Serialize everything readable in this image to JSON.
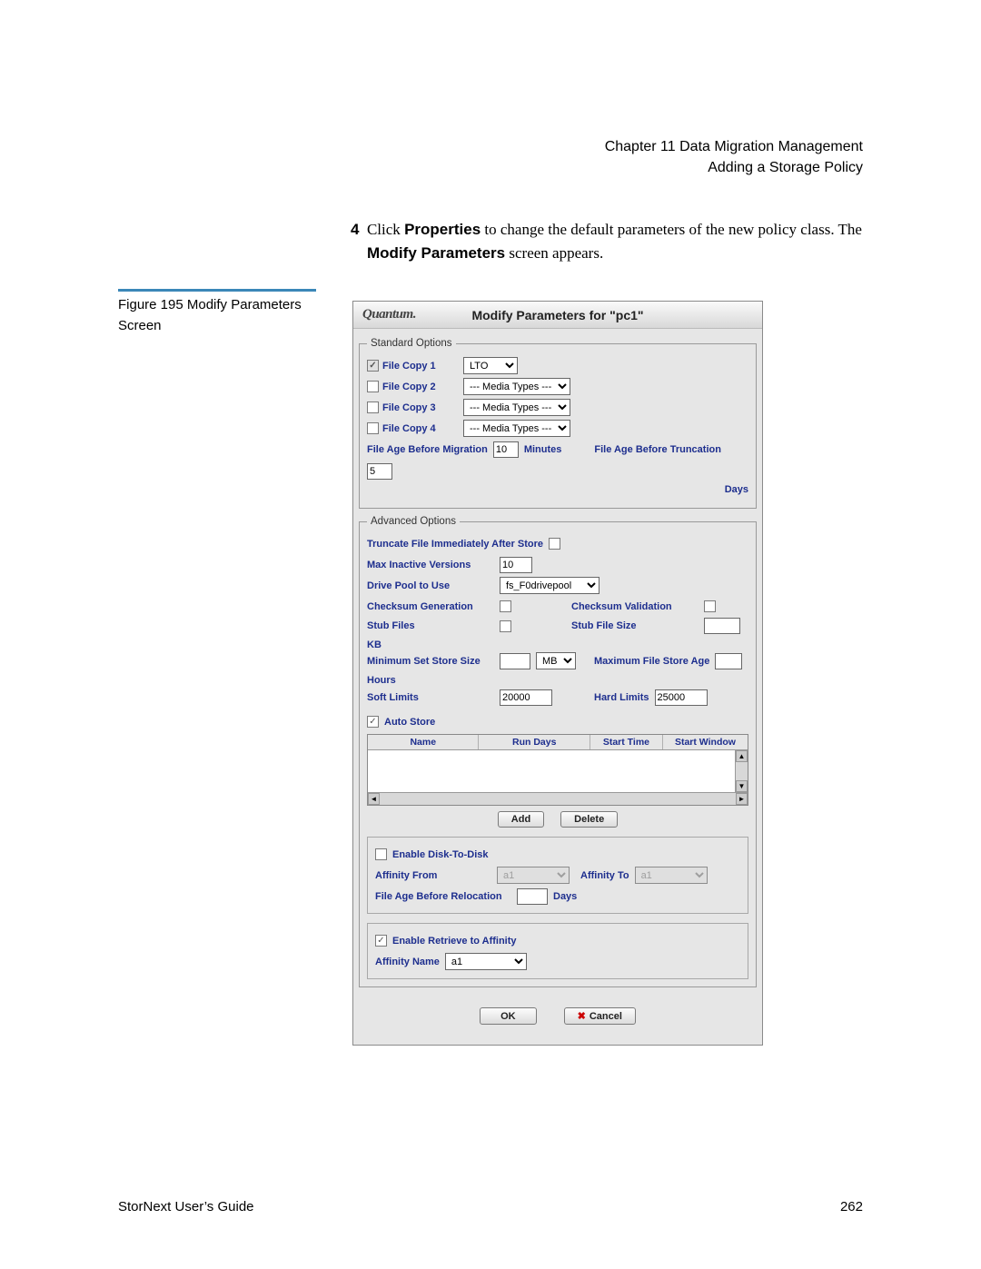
{
  "header": {
    "chapter": "Chapter 11  Data Migration Management",
    "section": "Adding a Storage Policy"
  },
  "step": {
    "num": "4",
    "text_before": "Click ",
    "bold1": "Properties",
    "text_mid": " to change the default parameters of the new policy class. The ",
    "bold2": "Modify Parameters",
    "text_after": " screen appears."
  },
  "figure_caption": "Figure 195  Modify Parameters Screen",
  "dialog": {
    "logo": "Quantum.",
    "title": "Modify Parameters for \"pc1\"",
    "standard": {
      "legend": "Standard Options",
      "fc1": "File Copy 1",
      "fc2": "File Copy 2",
      "fc3": "File Copy 3",
      "fc4": "File Copy 4",
      "fc1_sel": "LTO",
      "media_placeholder": "--- Media Types ---",
      "age_mig_label": "File Age Before Migration",
      "age_mig_val": "10",
      "minutes": "Minutes",
      "age_trunc_label": "File Age Before Truncation",
      "age_trunc_val": "5",
      "days": "Days"
    },
    "advanced": {
      "legend": "Advanced Options",
      "trunc_label": "Truncate File Immediately After Store",
      "max_inactive_label": "Max Inactive Versions",
      "max_inactive_val": "10",
      "drive_pool_label": "Drive Pool to Use",
      "drive_pool_val": "fs_F0drivepool",
      "cksum_gen": "Checksum Generation",
      "cksum_val": "Checksum Validation",
      "stub_files": "Stub Files",
      "stub_size": "Stub File Size",
      "kb": "KB",
      "min_set": "Minimum Set Store Size",
      "mb": "MB",
      "max_file_age": "Maximum File Store Age",
      "hours": "Hours",
      "soft": "Soft Limits",
      "soft_val": "20000",
      "hard": "Hard Limits",
      "hard_val": "25000",
      "auto_store": "Auto Store",
      "sched_name": "Name",
      "sched_run": "Run Days",
      "sched_start": "Start Time",
      "sched_win": "Start Window",
      "add": "Add",
      "delete": "Delete",
      "d2d": "Enable Disk-To-Disk",
      "aff_from": "Affinity From",
      "aff_from_val": "a1",
      "aff_to": "Affinity To",
      "aff_to_val": "a1",
      "age_reloc": "File Age Before Relocation",
      "days": "Days",
      "retrieve_aff": "Enable Retrieve to Affinity",
      "aff_name": "Affinity Name",
      "aff_name_val": "a1"
    },
    "ok": "OK",
    "cancel": "Cancel"
  },
  "footer": {
    "left": "StorNext User’s Guide",
    "right": "262"
  }
}
